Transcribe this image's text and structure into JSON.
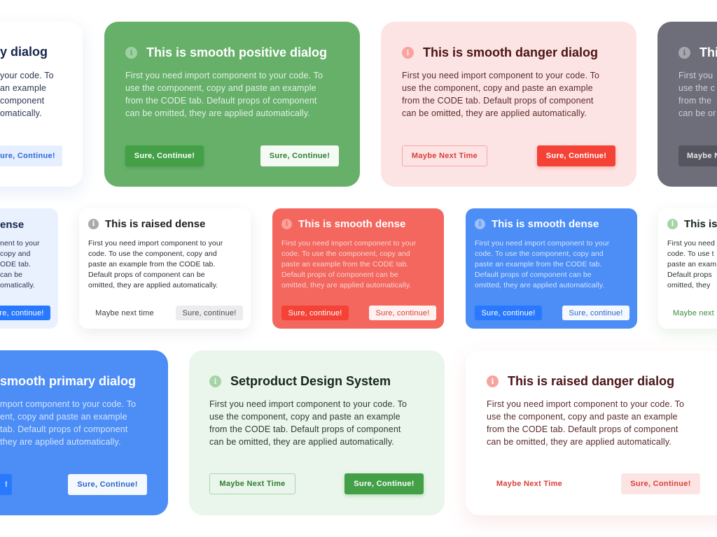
{
  "body_text": {
    "lines": [
      "First you need import component to your code. To",
      "use the component, copy and paste an example",
      "from the CODE tab. Default props of component",
      "can be omitted, they are applied automatically."
    ],
    "dense_lines": [
      "First you need import component to your",
      "code. To use the component, copy and",
      "paste an example from the CODE tab.",
      "Default props of component can be",
      "omitted, they are applied automatically."
    ]
  },
  "icon": {
    "name": "info-icon",
    "glyph": "i"
  },
  "colors": {
    "positive": "#43a047",
    "danger": "#f44336",
    "primary": "#2979ff",
    "neutral": "#6e6e7a"
  },
  "cards": {
    "primary_raised_large": {
      "title": "This is raised primary dialog",
      "title_visible": "y dialog",
      "lines_visible": [
        "your code. To",
        "an example",
        "component",
        "omatically."
      ],
      "primary_button": "Sure, Continue!",
      "primary_button_visible": "ure, Continue!"
    },
    "smooth_positive": {
      "title": "This is smooth positive dialog",
      "secondary_button": "Sure, Continue!",
      "primary_button": "Sure, Continue!"
    },
    "smooth_danger": {
      "title": "This is smooth danger dialog",
      "secondary_button": "Maybe Next Time",
      "primary_button": "Sure, Continue!"
    },
    "smooth_neutral": {
      "title_visible": "Thi",
      "lines_visible": [
        "First you",
        "use the c",
        "from the",
        "can be or"
      ],
      "secondary_button_visible": "Maybe N"
    },
    "smooth_primary_dense_left": {
      "title_visible": "ense",
      "lines_visible": [
        "nent to your",
        "copy and",
        "ODE tab.",
        "can be",
        "omatically."
      ],
      "primary_button_visible": "re, continue!"
    },
    "raised_dense": {
      "title": "This is raised dense",
      "secondary_button": "Maybe next time",
      "primary_button": "Sure, continue!"
    },
    "smooth_dense_danger": {
      "title": "This is smooth dense",
      "secondary_button": "Sure, continue!",
      "primary_button": "Sure, continue!"
    },
    "smooth_dense_primary": {
      "title": "This is smooth dense",
      "secondary_button": "Sure, continue!",
      "primary_button": "Sure, continue!"
    },
    "raised_dense_positive": {
      "title_visible": "This is",
      "lines_visible": [
        "First you need",
        "code. To use t",
        "paste an exam",
        "Default props",
        "omitted, they"
      ],
      "secondary_button_visible": "Maybe next"
    },
    "smooth_primary_large": {
      "title_visible": "smooth primary dialog",
      "lines_visible": [
        "mport component to your code. To",
        "ent, copy and paste an example",
        "tab. Default props of component",
        "they are applied automatically."
      ],
      "secondary_button_visible": "!",
      "primary_button": "Sure, Continue!"
    },
    "setproduct": {
      "title": "Setproduct Design System",
      "secondary_button": "Maybe Next Time",
      "primary_button": "Sure, Continue!"
    },
    "raised_danger": {
      "title": "This is raised danger dialog",
      "secondary_button": "Maybe Next Time",
      "primary_button": "Sure, Continue!"
    }
  }
}
